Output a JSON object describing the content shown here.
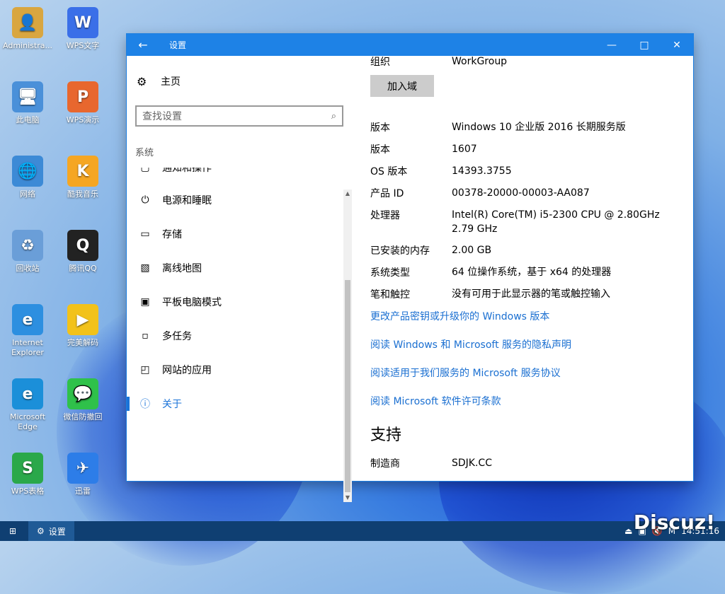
{
  "desktop": {
    "icons": [
      {
        "label": "Administra...",
        "glyph": "👤",
        "color": "#d9a640"
      },
      {
        "label": "WPS文字",
        "glyph": "W",
        "color": "#3a6fe8"
      },
      {
        "label": "此电脑",
        "glyph": "🖥",
        "color": "#4a90d9"
      },
      {
        "label": "WPS演示",
        "glyph": "P",
        "color": "#e8672e"
      },
      {
        "label": "网络",
        "glyph": "🌐",
        "color": "#3c8ad6"
      },
      {
        "label": "酷我音乐",
        "glyph": "K",
        "color": "#f5a623"
      },
      {
        "label": "回收站",
        "glyph": "♻",
        "color": "#6a9ed8"
      },
      {
        "label": "腾讯QQ",
        "glyph": "Q",
        "color": "#222222"
      },
      {
        "label": "Internet Explorer",
        "glyph": "e",
        "color": "#2d8fe0"
      },
      {
        "label": "完美解码",
        "glyph": "▶",
        "color": "#f2c21a"
      },
      {
        "label": "Microsoft Edge",
        "glyph": "e",
        "color": "#1b8fd9"
      },
      {
        "label": "微信防撤回",
        "glyph": "💬",
        "color": "#2fc14a"
      },
      {
        "label": "WPS表格",
        "glyph": "S",
        "color": "#2aa84a"
      },
      {
        "label": "迅雷",
        "glyph": "✈",
        "color": "#2d7de8"
      }
    ]
  },
  "window": {
    "title": "设置",
    "back_glyph": "←",
    "minimize": "—",
    "maximize": "□",
    "close": "✕"
  },
  "sidebar": {
    "home_label": "主页",
    "home_icon": "⚙",
    "search_placeholder": "查找设置",
    "search_icon": "⌕",
    "section_label": "系统",
    "items": [
      {
        "label": "通知和操作",
        "icon": "▢"
      },
      {
        "label": "电源和睡眠",
        "icon": "⏻"
      },
      {
        "label": "存储",
        "icon": "▭"
      },
      {
        "label": "离线地图",
        "icon": "▧"
      },
      {
        "label": "平板电脑模式",
        "icon": "▣"
      },
      {
        "label": "多任务",
        "icon": "▫"
      },
      {
        "label": "网站的应用",
        "icon": "◰"
      },
      {
        "label": "关于",
        "icon": "ⓘ"
      }
    ]
  },
  "content": {
    "org_label": "组织",
    "org_value": "WorkGroup",
    "join_button": "加入域",
    "specs": [
      {
        "k": "版本",
        "v": "Windows 10 企业版 2016 长期服务版"
      },
      {
        "k": "版本",
        "v": "1607"
      },
      {
        "k": "OS 版本",
        "v": "14393.3755"
      },
      {
        "k": "产品 ID",
        "v": "00378-20000-00003-AA087"
      },
      {
        "k": "处理器",
        "v": "Intel(R) Core(TM) i5-2300 CPU @ 2.80GHz 2.79 GHz"
      },
      {
        "k": "已安装的内存",
        "v": "2.00 GB"
      },
      {
        "k": "系统类型",
        "v": "64 位操作系统，基于 x64 的处理器"
      },
      {
        "k": "笔和触控",
        "v": "没有可用于此显示器的笔或触控输入"
      }
    ],
    "links": [
      "更改产品密钥或升级你的 Windows 版本",
      "阅读 Windows 和 Microsoft 服务的隐私声明",
      "阅读适用于我们服务的 Microsoft 服务协议",
      "阅读 Microsoft 软件许可条款"
    ],
    "support_title": "支持",
    "manufacturer_label": "制造商",
    "manufacturer_value": "SDJK.CC"
  },
  "taskbar": {
    "start_glyph": "⊞",
    "app_label": "设置",
    "app_icon": "⚙",
    "clock": "14:51:16"
  },
  "watermark": "Discuz!"
}
